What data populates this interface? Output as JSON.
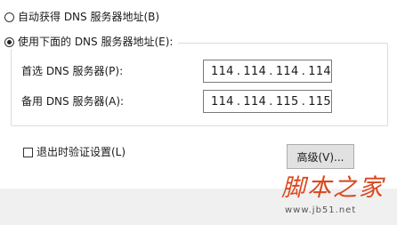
{
  "options": {
    "auto_dns_label": "自动获得 DNS 服务器地址(B)",
    "manual_dns_label": "使用下面的 DNS 服务器地址(E):",
    "selected": "manual"
  },
  "preferred_dns": {
    "label": "首选 DNS 服务器(P):",
    "octets": [
      "114",
      "114",
      "114",
      "114"
    ]
  },
  "alternate_dns": {
    "label": "备用 DNS 服务器(A):",
    "octets": [
      "114",
      "114",
      "115",
      "115"
    ]
  },
  "validate_on_exit": {
    "label": "退出时验证设置(L)",
    "checked": false
  },
  "advanced_button_label": "高级(V)...",
  "watermark": {
    "title": "脚本之家",
    "url": "www.jb51.net"
  }
}
